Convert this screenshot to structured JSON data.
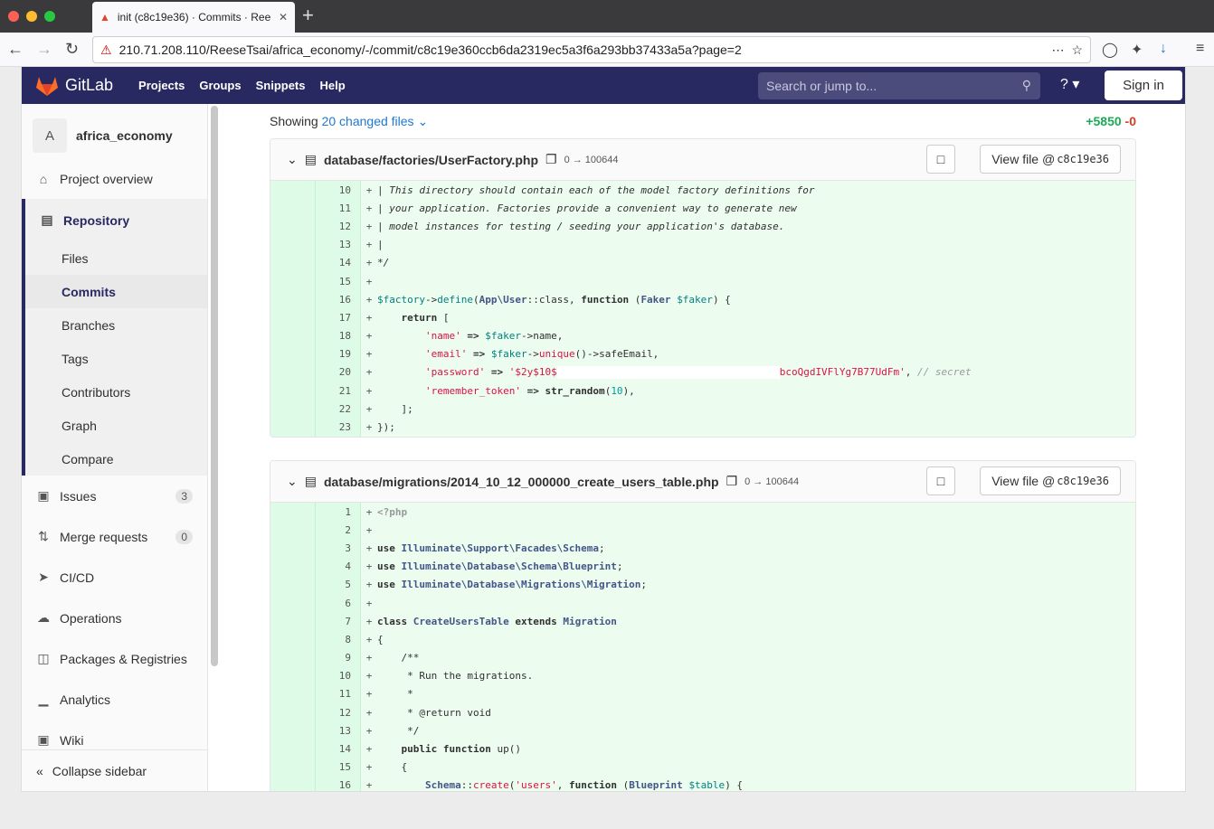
{
  "browser": {
    "tab_title": "init (c8c19e36) · Commits · Ree",
    "url": "210.71.208.110/ReeseTsai/africa_economy/-/commit/c8c19e360ccb6da2319ec5a3f6a293bb37433a5a?page=2"
  },
  "navbar": {
    "brand": "GitLab",
    "links": [
      "Projects",
      "Groups",
      "Snippets",
      "Help"
    ],
    "search_placeholder": "Search or jump to...",
    "signin": "Sign in"
  },
  "sidebar": {
    "project_initial": "A",
    "project_name": "africa_economy",
    "overview": "Project overview",
    "repository": "Repository",
    "repo_items": [
      "Files",
      "Commits",
      "Branches",
      "Tags",
      "Contributors",
      "Graph",
      "Compare"
    ],
    "issues": {
      "label": "Issues",
      "count": "3"
    },
    "merge_requests": {
      "label": "Merge requests",
      "count": "0"
    },
    "cicd": "CI/CD",
    "operations": "Operations",
    "packages": "Packages & Registries",
    "analytics": "Analytics",
    "wiki": "Wiki",
    "collapse": "Collapse sidebar"
  },
  "summary": {
    "showing": "Showing",
    "changed": "20 changed files",
    "additions": "+5850",
    "deletions": "-0"
  },
  "files": [
    {
      "path": "database/factories/UserFactory.php",
      "mode": "0 → 100644",
      "view_label": "View file @",
      "sha": "c8c19e36"
    },
    {
      "path": "database/migrations/2014_10_12_000000_create_users_table.php",
      "mode": "0 → 100644",
      "view_label": "View file @",
      "sha": "c8c19e36"
    }
  ],
  "colors": {
    "navbar": "#292961",
    "added_bg": "#ecfdf0",
    "link": "#1f78d1"
  }
}
